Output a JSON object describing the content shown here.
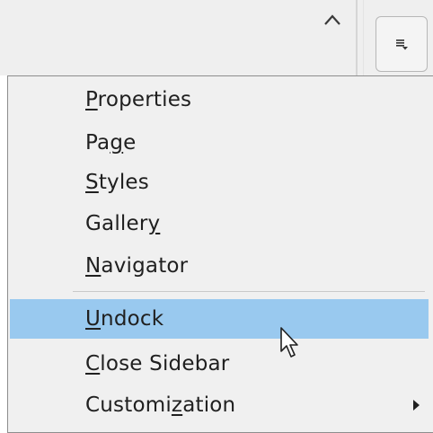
{
  "toolbar": {
    "scroll_up_icon": "chevron-up-icon",
    "deck_menu_icon": "menu-dropdown-icon"
  },
  "menu": {
    "items": [
      {
        "label": "Properties",
        "mnemonic_index": 0,
        "highlighted": false,
        "submenu": false
      },
      {
        "label": "Page",
        "mnemonic_index": 2,
        "highlighted": false,
        "submenu": false
      },
      {
        "label": "Styles",
        "mnemonic_index": 0,
        "highlighted": false,
        "submenu": false
      },
      {
        "label": "Gallery",
        "mnemonic_index": 6,
        "highlighted": false,
        "submenu": false
      },
      {
        "label": "Navigator",
        "mnemonic_index": 0,
        "highlighted": false,
        "submenu": false
      },
      {
        "label": "Undock",
        "mnemonic_index": 0,
        "highlighted": true,
        "submenu": false
      },
      {
        "label": "Close Sidebar",
        "mnemonic_index": 0,
        "highlighted": false,
        "submenu": false
      },
      {
        "label": "Customization",
        "mnemonic_index": 7,
        "highlighted": false,
        "submenu": true
      }
    ]
  },
  "colors": {
    "highlight": "#99c9ef",
    "menu_bg": "#f0f0f0",
    "toolbar_bg": "#efefef",
    "text": "#202020"
  }
}
